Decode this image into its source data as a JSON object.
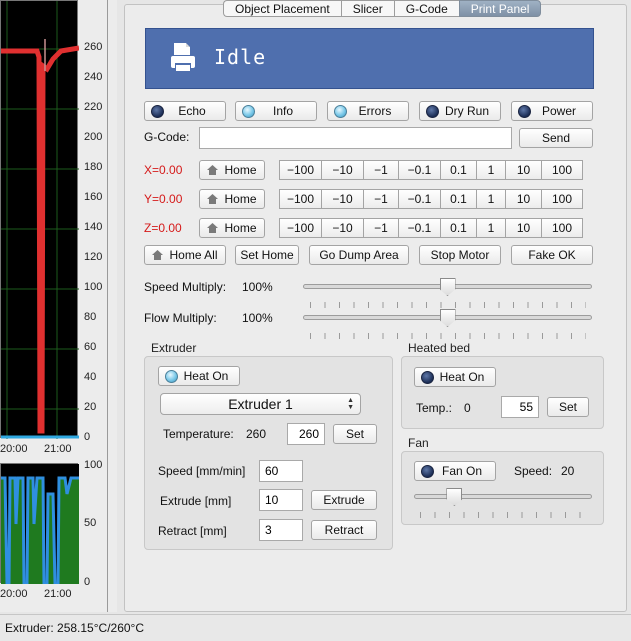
{
  "tabs": [
    "Object Placement",
    "Slicer",
    "G-Code",
    "Print Panel"
  ],
  "status": {
    "text": "Idle",
    "icon": "printer-icon"
  },
  "toggles": [
    {
      "label": "Echo",
      "on": false
    },
    {
      "label": "Info",
      "on": true
    },
    {
      "label": "Errors",
      "on": true
    },
    {
      "label": "Dry Run",
      "on": false
    },
    {
      "label": "Power",
      "on": false
    }
  ],
  "gcode": {
    "label": "G-Code:",
    "value": "",
    "send_label": "Send"
  },
  "axes": [
    {
      "label": "X=0.00",
      "home_label": "Home"
    },
    {
      "label": "Y=0.00",
      "home_label": "Home"
    },
    {
      "label": "Z=0.00",
      "home_label": "Home"
    }
  ],
  "steps": [
    "−100",
    "−10",
    "−1",
    "−0.1",
    "0.1",
    "1",
    "10",
    "100"
  ],
  "actions": {
    "home_all": "Home All",
    "set_home": "Set Home",
    "dump": "Go Dump Area",
    "stop": "Stop Motor",
    "fake_ok": "Fake OK"
  },
  "speed_multiply": {
    "label": "Speed Multiply:",
    "value": "100%",
    "level": 0.5
  },
  "flow_multiply": {
    "label": "Flow Multiply:",
    "value": "100%",
    "level": 0.5
  },
  "extruder": {
    "title": "Extruder",
    "heat_label": "Heat On",
    "heat_on": true,
    "selected": "Extruder 1",
    "temp_label": "Temperature:",
    "temp_current": "260",
    "temp_target": "260",
    "set_label": "Set",
    "speed_label": "Speed [mm/min]",
    "speed_value": "60",
    "extrude_label": "Extrude [mm]",
    "extrude_value": "10",
    "extrude_button": "Extrude",
    "retract_label": "Retract [mm]",
    "retract_value": "3",
    "retract_button": "Retract"
  },
  "bed": {
    "title": "Heated bed",
    "heat_label": "Heat On",
    "heat_on": false,
    "temp_label": "Temp.:",
    "temp_current": "0",
    "temp_target": "55",
    "set_label": "Set"
  },
  "fan": {
    "title": "Fan",
    "fan_label": "Fan On",
    "fan_on": false,
    "speed_label": "Speed:",
    "speed_value": "20",
    "level": 0.2
  },
  "chart_top": {
    "y_ticks": [
      "260",
      "240",
      "220",
      "200",
      "180",
      "160",
      "140",
      "120",
      "100",
      "80",
      "60",
      "40",
      "20",
      "0"
    ],
    "x_ticks": [
      "20:00",
      "21:00"
    ]
  },
  "chart_bottom": {
    "y_ticks": [
      "100",
      "50",
      "0"
    ],
    "x_ticks": [
      "20:00",
      "21:00"
    ]
  },
  "status_bar": {
    "text": "Extruder: 258.15°C/260°C"
  },
  "colors": {
    "banner": "#4f6fae",
    "axis_label": "#d51a1a",
    "temp_line": "#e03030",
    "bed_fill": "#1f7a1f",
    "fan_line": "#2f8fe0"
  }
}
